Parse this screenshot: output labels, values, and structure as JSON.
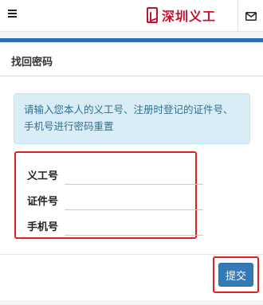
{
  "header": {
    "logo_text": "深圳义工",
    "menu_icon": "hamburger-icon",
    "mail_icon": "envelope-icon",
    "brand_color": "#c8102e"
  },
  "panel": {
    "title": "找回密码",
    "notice": "请输入您本人的义工号、注册时登记的证件号、手机号进行密码重置",
    "fields": [
      {
        "label": "义工号",
        "value": ""
      },
      {
        "label": "证件号",
        "value": ""
      },
      {
        "label": "手机号",
        "value": ""
      }
    ],
    "submit_label": "提交"
  },
  "colors": {
    "accent": "#2a6db2",
    "alert_bg": "#d9edf7",
    "alert_text": "#31708f",
    "primary_button": "#337ab7",
    "highlight_box": "#e02020"
  }
}
